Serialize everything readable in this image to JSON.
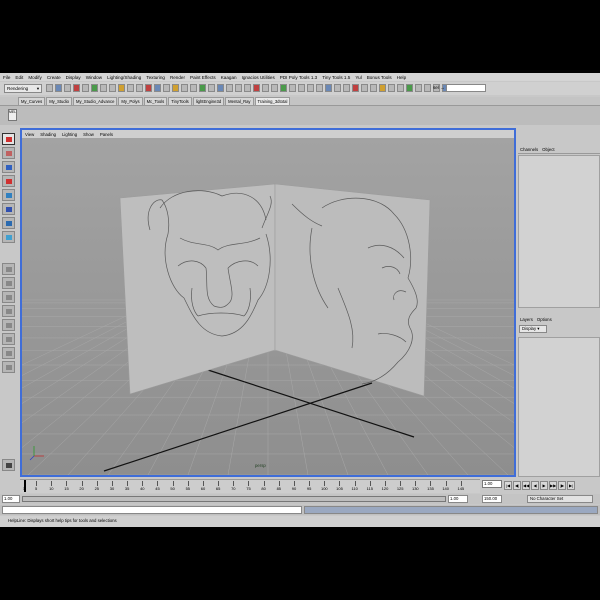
{
  "menubar": {
    "items": [
      "File",
      "Edit",
      "Modify",
      "Create",
      "Display",
      "Window",
      "Lighting/Shading",
      "Texturing",
      "Render",
      "Paint Effects",
      "Kaagan",
      "Ignacios Utilities",
      "PDI Poly Tools 1.3",
      "Tiny Tools 1.5",
      "Yul",
      "Bonus Tools",
      "Help"
    ]
  },
  "statusline": {
    "mode": "Rendering",
    "sel_label": "sel →"
  },
  "shelf": {
    "tabs": [
      "My_Curves",
      "My_Studio",
      "My_Studio_Advance",
      "My_Polys",
      "Mc_Tools",
      "TinyTools",
      "lightEngine3d",
      "Mental_Ray",
      "Training_3dtotal"
    ],
    "active_tab": "Training_3dtotal",
    "icon_label": "MEL"
  },
  "viewport": {
    "menu": [
      "View",
      "Shading",
      "Lighting",
      "Show",
      "Panels"
    ],
    "camera": "persp",
    "sketch_subject": "sketches of a head (front and side)",
    "grid": true
  },
  "channelbox": {
    "tabs": [
      "Channels",
      "Object"
    ]
  },
  "layers": {
    "tabs": [
      "Layers",
      "Options"
    ],
    "display": "Display"
  },
  "timeslider": {
    "ticks": [
      1,
      5,
      10,
      15,
      20,
      25,
      30,
      35,
      40,
      45,
      50,
      55,
      60,
      65,
      70,
      75,
      80,
      85,
      90,
      95,
      100,
      105,
      110,
      115,
      120,
      125,
      130,
      135,
      140,
      145
    ],
    "current_frame": "1.00"
  },
  "playback": [
    "|◀",
    "◀|",
    "◀◀",
    "◀",
    "▶",
    "▶▶",
    "|▶",
    "▶|"
  ],
  "rangeslider": {
    "start": "1.00",
    "start2": "1.00",
    "end": "150.00",
    "end2": "150.00",
    "character_set": "No Character Set"
  },
  "helpline": {
    "text": "HelpLine: Displays short help tips for tools and selections"
  },
  "colors": {
    "viewport_border": "#3f6dd8",
    "viewport_bg": "#9a9a9a",
    "ui_gray": "#c8c8c8"
  }
}
